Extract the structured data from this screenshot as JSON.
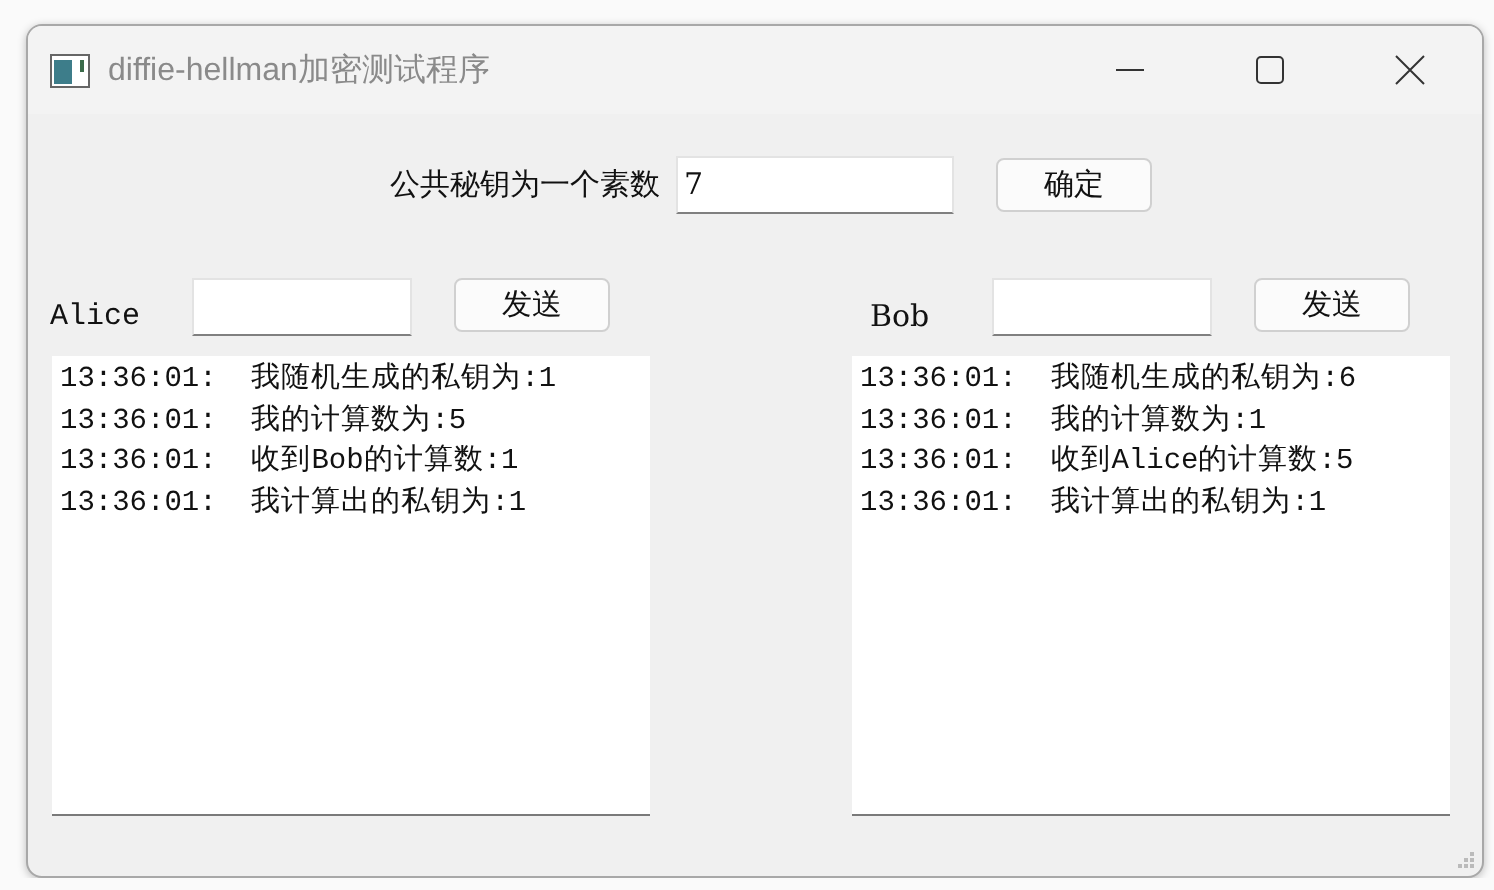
{
  "window": {
    "title": "diffie-hellman加密测试程序"
  },
  "prime": {
    "label": "公共秘钥为一个素数",
    "value": "7",
    "button": "确定"
  },
  "parties": [
    {
      "name": "Alice",
      "button": "发送",
      "log": [
        {
          "time": "13:36:01:",
          "message": "我随机生成的私钥为:1"
        },
        {
          "time": "13:36:01:",
          "message": "我的计算数为:5"
        },
        {
          "time": "13:36:01:",
          "message": "收到Bob的计算数:1"
        },
        {
          "time": "13:36:01:",
          "message": "我计算出的私钥为:1"
        }
      ]
    },
    {
      "name": "Bob",
      "button": "发送",
      "log": [
        {
          "time": "13:36:01:",
          "message": "我随机生成的私钥为:6"
        },
        {
          "time": "13:36:01:",
          "message": "我的计算数为:1"
        },
        {
          "time": "13:36:01:",
          "message": "收到Alice的计算数:5"
        },
        {
          "time": "13:36:01:",
          "message": "我计算出的私钥为:1"
        }
      ]
    }
  ]
}
